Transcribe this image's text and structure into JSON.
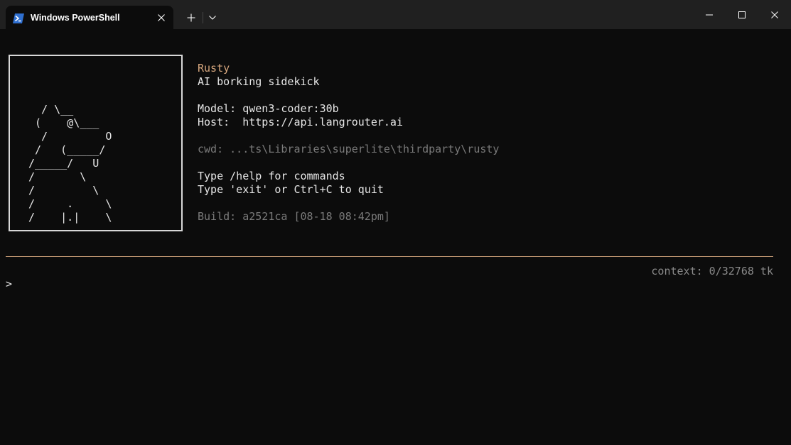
{
  "window": {
    "tab_title": "Windows PowerShell",
    "icons": {
      "tab": "powershell-icon",
      "tab_close": "close-icon",
      "new_tab": "plus-icon",
      "dropdown": "chevron-down-icon",
      "minimize": "minimize-icon",
      "maximize": "maximize-icon",
      "close": "close-icon"
    }
  },
  "banner": {
    "ascii_art": "  / \\__\n (    @\\___\n  /         O\n /   (_____/\n/_____/   U\n/       \\\n/         \\\n/     .     \\\n/    |.|    \\",
    "name": "Rusty",
    "tagline": "AI borking sidekick",
    "model_line": "Model: qwen3-coder:30b",
    "host_line": "Host:  https://api.langrouter.ai",
    "cwd_line": "cwd: ...ts\\Libraries\\superlite\\thirdparty\\rusty",
    "help_line": "Type /help for commands",
    "quit_line": "Type 'exit' or Ctrl+C to quit",
    "build_line": "Build: a2521ca [08-18 08:42pm]"
  },
  "status": {
    "context": "context: 0/32768 tk"
  },
  "prompt": {
    "symbol": ">"
  },
  "colors": {
    "background": "#0c0c0c",
    "titlebar": "#202020",
    "accent": "#d7a77e",
    "rule": "#c89d76",
    "text": "#e6e6e6",
    "dim": "#7a7a7a"
  }
}
